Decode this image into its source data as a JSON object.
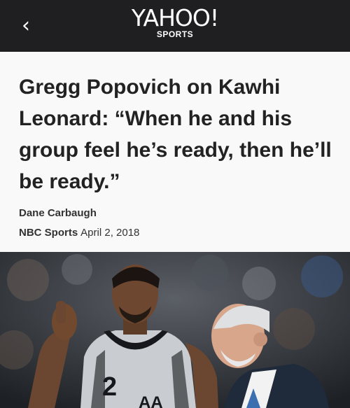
{
  "nav": {
    "back_icon": "chevron-left-icon",
    "brand": "YAHOO!",
    "section": "SPORTS",
    "bar_color": "#1f1f21"
  },
  "article": {
    "headline": "Gregg Popovich on Kawhi Leonard: “When he and his group feel he’s ready, then he’ll be ready.”",
    "author": "Dane Carbaugh",
    "source": "NBC Sports",
    "date": "April 2, 2018"
  },
  "photo": {
    "jersey_number": "2"
  }
}
